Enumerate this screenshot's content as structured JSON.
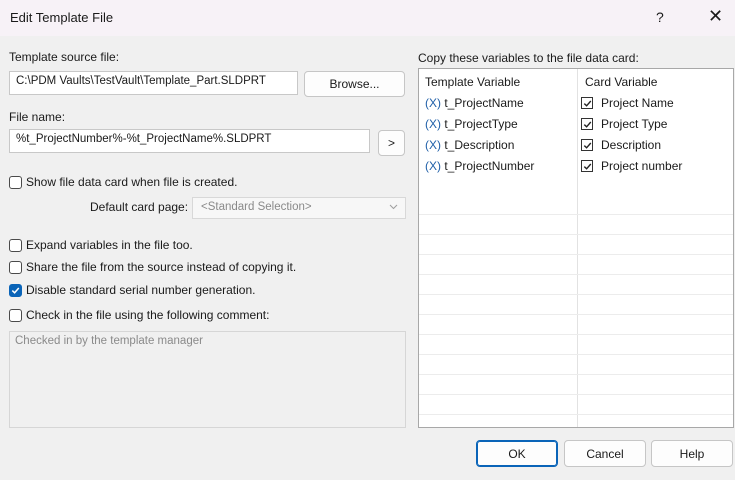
{
  "window": {
    "title": "Edit Template File",
    "help_glyph": "?",
    "close_glyph": "✕"
  },
  "source": {
    "label": "Template source file:",
    "value": "C:\\PDM Vaults\\TestVault\\Template_Part.SLDPRT",
    "browse_label": "Browse..."
  },
  "filename": {
    "label": "File name:",
    "value": "%t_ProjectNumber%-%t_ProjectName%.SLDPRT",
    "expand_label": ">"
  },
  "options": {
    "show_card": {
      "label": "Show file data card when file is created.",
      "checked": false
    },
    "default_card_label": "Default card page:",
    "default_card_value": "<Standard Selection>",
    "expand_vars": {
      "label": "Expand variables in the file too.",
      "checked": false
    },
    "share_file": {
      "label": "Share the file from the source instead of copying it.",
      "checked": false
    },
    "disable_serial": {
      "label": "Disable standard serial number generation.",
      "checked": true
    },
    "checkin_comment": {
      "label": "Check in the file using the following comment:",
      "checked": false
    },
    "comment_text": "Checked in by the template manager"
  },
  "variables": {
    "label": "Copy these variables to the file data card:",
    "col_template": "Template Variable",
    "col_card": "Card Variable",
    "rows": [
      {
        "mark": "(X)",
        "template": "t_ProjectName",
        "card": "Project Name",
        "checked": true
      },
      {
        "mark": "(X)",
        "template": "t_ProjectType",
        "card": "Project Type",
        "checked": true
      },
      {
        "mark": "(X)",
        "template": "t_Description",
        "card": "Description",
        "checked": true
      },
      {
        "mark": "(X)",
        "template": "t_ProjectNumber",
        "card": "Project number",
        "checked": true
      }
    ]
  },
  "buttons": {
    "ok": "OK",
    "cancel": "Cancel",
    "help": "Help"
  },
  "colors": {
    "accent": "#0a64b8",
    "variable_mark": "#1f5fa8"
  }
}
